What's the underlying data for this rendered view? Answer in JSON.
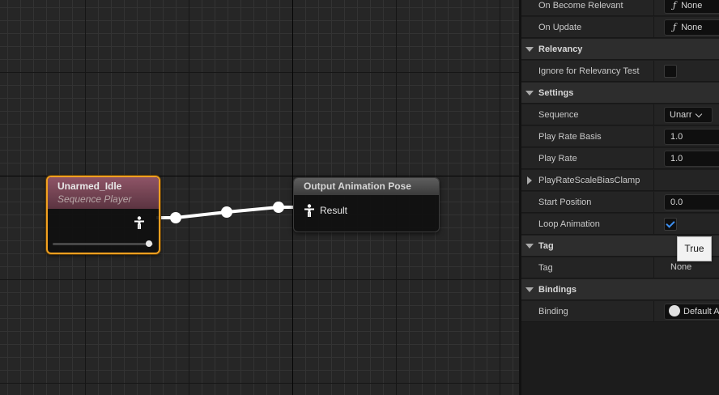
{
  "graph": {
    "nodes": {
      "sequence_player": {
        "title": "Unarmed_Idle",
        "subtitle": "Sequence Player"
      },
      "output_pose": {
        "title": "Output Animation Pose",
        "input_label": "Result"
      }
    },
    "icons": [
      "pose-icon",
      "wire-reroute-icon"
    ]
  },
  "details": {
    "rows": {
      "on_become_relevant": {
        "label": "On Become Relevant",
        "value": "None"
      },
      "on_update": {
        "label": "On Update",
        "value": "None"
      },
      "cat_relevancy": {
        "label": "Relevancy"
      },
      "ignore_relevancy": {
        "label": "Ignore for Relevancy Test",
        "checked": false
      },
      "cat_settings": {
        "label": "Settings"
      },
      "sequence": {
        "label": "Sequence",
        "value": "Unarr"
      },
      "play_rate_basis": {
        "label": "Play Rate Basis",
        "value": "1.0"
      },
      "play_rate": {
        "label": "Play Rate",
        "value": "1.0"
      },
      "play_rate_clamp": {
        "label": "PlayRateScaleBiasClamp"
      },
      "start_position": {
        "label": "Start Position",
        "value": "0.0"
      },
      "loop_animation": {
        "label": "Loop Animation",
        "checked": true
      },
      "cat_tag": {
        "label": "Tag"
      },
      "tag": {
        "label": "Tag",
        "value": "None"
      },
      "cat_bindings": {
        "label": "Bindings"
      },
      "binding": {
        "label": "Binding",
        "value": "Default A"
      }
    },
    "function_glyph": "ƒ",
    "tooltip": "True"
  },
  "colors": {
    "selection_outline": "#f0a020",
    "sequence_header": "#8e5466",
    "checkbox_accent": "#3d8ff0",
    "wire": "#ffffff"
  }
}
